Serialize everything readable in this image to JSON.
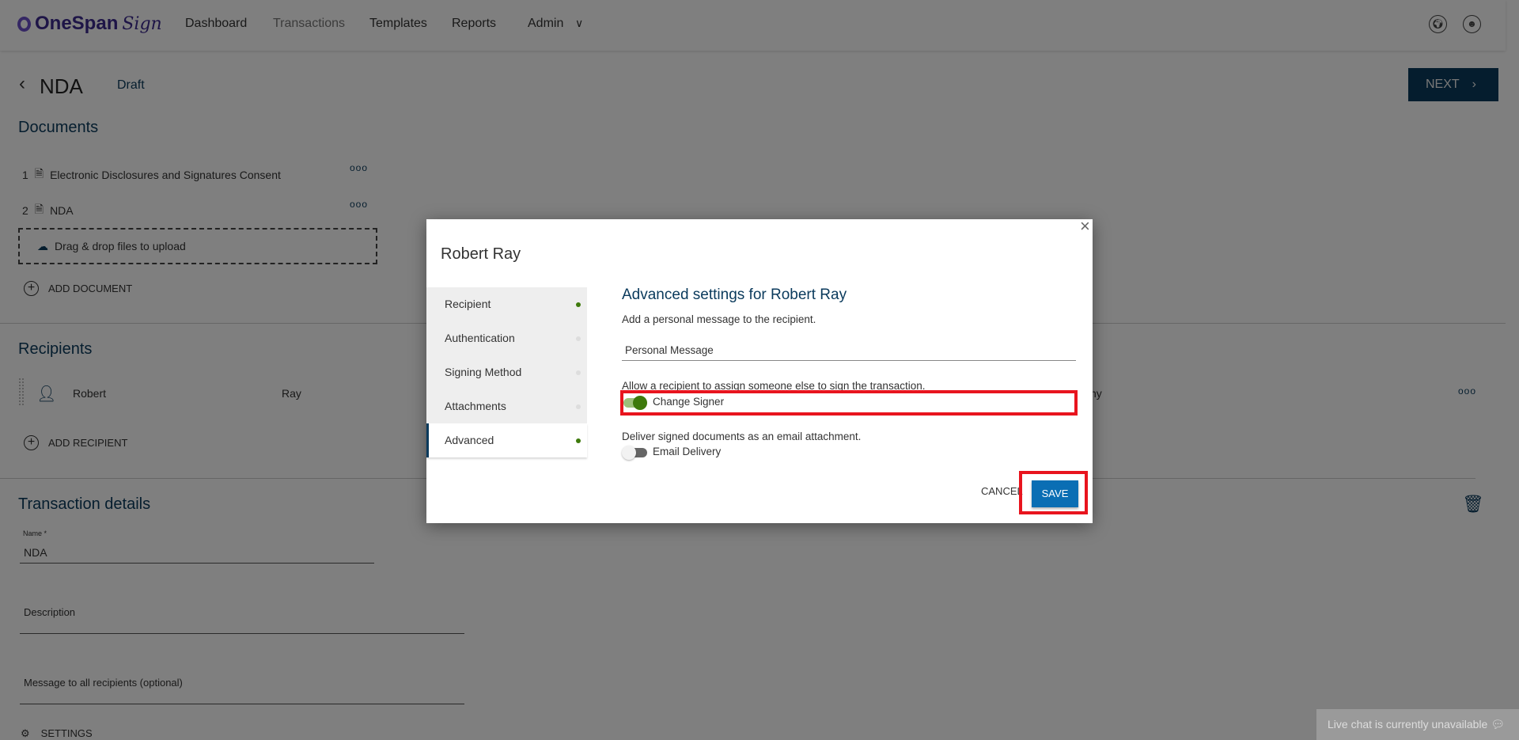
{
  "header": {
    "logo": "OneSpan",
    "logo_script": "Sign",
    "nav": [
      "Dashboard",
      "Transactions",
      "Templates",
      "Reports",
      "Admin"
    ],
    "icons": [
      "globe-icon",
      "user-profile-icon"
    ]
  },
  "page": {
    "title": "NDA",
    "status": "Draft",
    "next_label": "NEXT"
  },
  "documents": {
    "title": "Documents",
    "items": [
      {
        "index": "1",
        "name": "Electronic Disclosures and Signatures Consent"
      },
      {
        "index": "2",
        "name": "NDA"
      }
    ],
    "dropzone": "Drag & drop files to upload",
    "add_label": "ADD DOCUMENT"
  },
  "recipients": {
    "title": "Recipients",
    "items": [
      {
        "first": "Robert",
        "last": "Ray",
        "partial": "ny"
      }
    ],
    "add_label": "ADD RECIPIENT"
  },
  "details": {
    "title": "Transaction details",
    "name_label": "Name *",
    "name_value": "NDA",
    "description_placeholder": "Description",
    "message_placeholder": "Message to all recipients (optional)",
    "settings_label": "SETTINGS"
  },
  "chat": {
    "text": "Live chat is currently unavailable"
  },
  "modal": {
    "title": "Robert Ray",
    "tabs": [
      {
        "label": "Recipient",
        "done": true
      },
      {
        "label": "Authentication",
        "done": false
      },
      {
        "label": "Signing Method",
        "done": false
      },
      {
        "label": "Attachments",
        "done": false
      },
      {
        "label": "Advanced",
        "done": true,
        "active": true
      }
    ],
    "heading": "Advanced settings for Robert Ray",
    "message_hint": "Add a personal message to the recipient.",
    "message_placeholder": "Personal Message",
    "change_signer_hint": "Allow a recipient to assign someone else to sign the transaction.",
    "change_signer_label": "Change Signer",
    "change_signer_on": true,
    "email_hint": "Deliver signed documents as an email attachment.",
    "email_label": "Email Delivery",
    "email_on": false,
    "cancel": "CANCEL",
    "save": "SAVE"
  },
  "colors": {
    "brand": "#0a3a5c",
    "primary_button": "#0a6eb4",
    "toggle_on": "#3e7a0c",
    "highlight": "#e8141e"
  }
}
